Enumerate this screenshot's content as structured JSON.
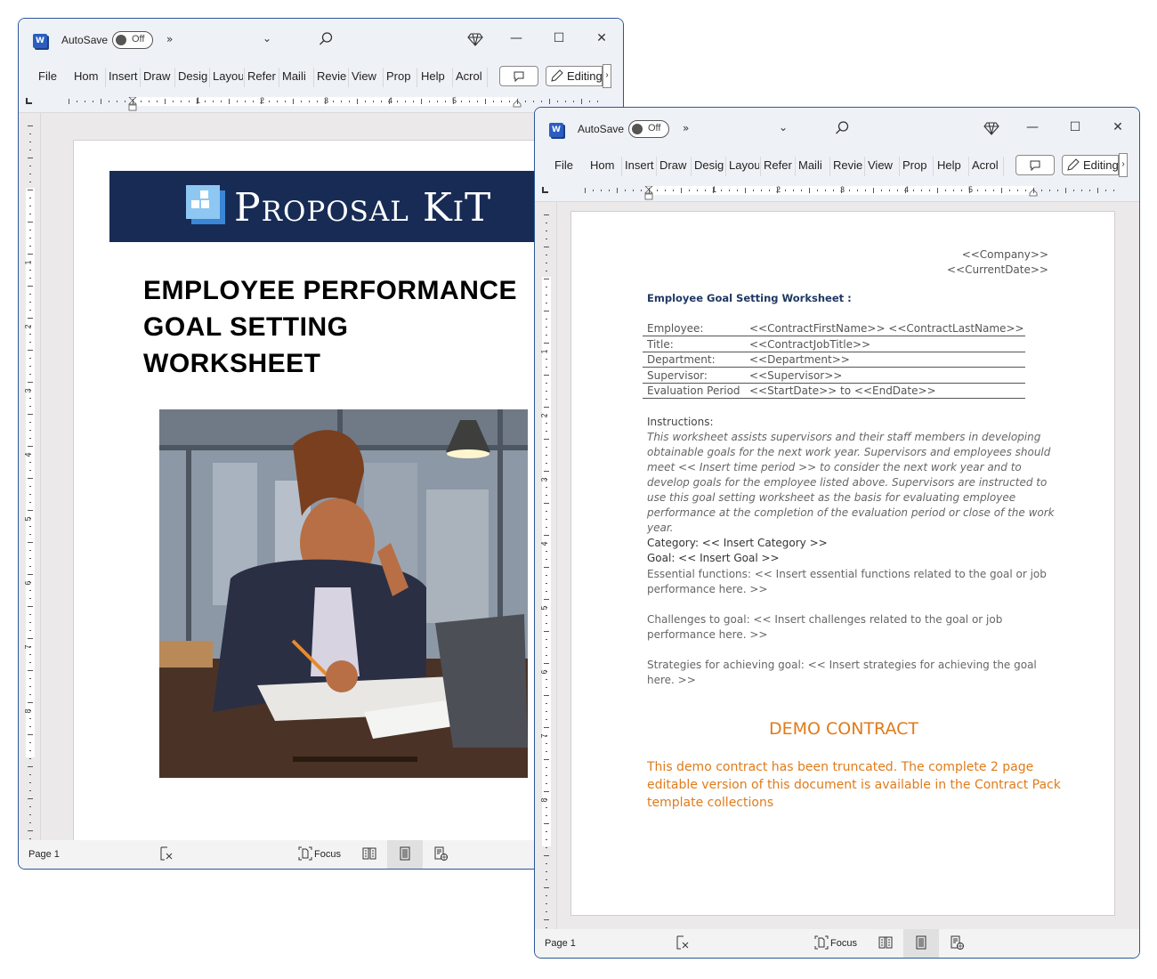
{
  "windows": [
    {
      "app_icon": "word-icon",
      "app_icon_letter": "W",
      "autosave_label": "AutoSave",
      "autosave_state": "Off",
      "more_commands": "»",
      "ribbon_tabs": [
        "File",
        "Hom",
        "Insert",
        "Draw",
        "Desig",
        "Layou",
        "Refer",
        "Maili",
        "Revie",
        "View",
        "Prop",
        "Help",
        "Acrol"
      ],
      "editing_label": "Editing",
      "ruler_numbers": [
        "1",
        "2",
        "3",
        "4",
        "5"
      ],
      "vruler_numbers": [
        "1",
        "2",
        "3",
        "4",
        "5",
        "6",
        "7",
        "8"
      ],
      "status": {
        "page": "Page 1",
        "focus": "Focus"
      }
    },
    {
      "app_icon": "word-icon",
      "app_icon_letter": "W",
      "autosave_label": "AutoSave",
      "autosave_state": "Off",
      "more_commands": "»",
      "ribbon_tabs": [
        "File",
        "Hom",
        "Insert",
        "Draw",
        "Desig",
        "Layou",
        "Refer",
        "Maili",
        "Revie",
        "View",
        "Prop",
        "Help",
        "Acrol"
      ],
      "editing_label": "Editing",
      "ruler_numbers": [
        "1",
        "2",
        "3",
        "4",
        "5"
      ],
      "vruler_numbers": [
        "1",
        "2",
        "3",
        "4",
        "5",
        "6",
        "7",
        "8"
      ],
      "status": {
        "page": "Page 1",
        "focus": "Focus"
      }
    }
  ],
  "cover": {
    "brand": "Proposal KiT",
    "title_lines": [
      "EMPLOYEE PERFORMANCE",
      "GOAL SETTING",
      "WORKSHEET"
    ],
    "image_alt": "Illustration of a businesswoman writing at a desk with a laptop and lamp"
  },
  "doc": {
    "company": "<<Company>>",
    "date": "<<CurrentDate>>",
    "heading": "Employee Goal Setting Worksheet  :",
    "fields": [
      {
        "label": "Employee:",
        "value": "<<ContractFirstName>> <<ContractLastName>>"
      },
      {
        "label": "Title:",
        "value": "<<ContractJobTitle>>"
      },
      {
        "label": "Department:",
        "value": "<<Department>>"
      },
      {
        "label": "Supervisor:",
        "value": "<<Supervisor>>"
      },
      {
        "label": "Evaluation Period",
        "value": "<<StartDate>> to <<EndDate>>"
      }
    ],
    "instructions_label": "Instructions:",
    "instructions_text": "This worksheet assists supervisors and their staff members in developing obtainable goals for the next work year.  Supervisors and employees should meet << Insert time period >> to consider the next work year and to develop goals for the employee listed above. Supervisors are instructed to use this goal setting worksheet as the basis for evaluating employee performance at the completion of the evaluation period or close of the work year.",
    "category": "Category: << Insert Category >>",
    "goal": "Goal: << Insert Goal >>",
    "essential": "Essential functions: << Insert essential functions related to the goal or job performance here. >>",
    "challenges": "Challenges to goal: << Insert challenges related to the goal or job performance here. >>",
    "strategies": "Strategies for achieving goal: << Insert strategies for achieving the goal here. >>",
    "demo_title": "DEMO CONTRACT",
    "demo_body": "This demo contract has been truncated. The complete 2 page editable version of this document is available in the Contract Pack template collections"
  },
  "colors": {
    "banner": "#172b55",
    "demo_accent": "#e07b1a",
    "heading_blue": "#1f3864",
    "window_border": "#2b5797"
  }
}
